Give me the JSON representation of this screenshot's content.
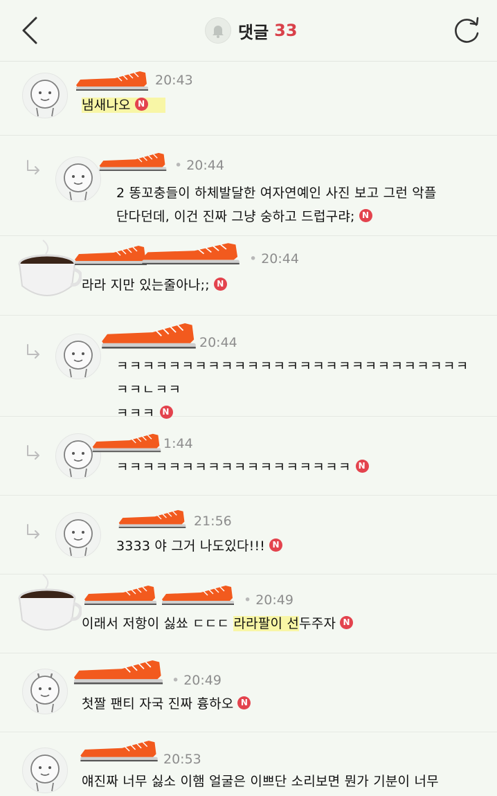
{
  "header": {
    "title": "댓글",
    "count": "33",
    "accent_color": "#d9414a",
    "back_icon": "chevron-left-icon",
    "refresh_icon": "refresh-icon",
    "bell_icon": "bell-icon"
  },
  "badge": "N",
  "comments": [
    {
      "time": "20:43",
      "text_a": "냄새나오",
      "text_b": "",
      "text_c": ""
    },
    {
      "time": "20:44",
      "text_a": "2 똥꼬충들이 하체발달한 여자연예인 사진 보고 그런 악플\n단다던데, 이건 진짜 그냥 숭하고 드럽구랴;",
      "text_b": "",
      "text_c": ""
    },
    {
      "time": "20:44",
      "text_a": "라라 지만 있는줄아나;;",
      "text_b": "",
      "text_c": ""
    },
    {
      "time": "20:44",
      "text_a": "ㅋㅋㅋㅋㅋㅋㅋㅋㅋㅋㅋㅋㅋㅋㅋㅋㅋㅋㅋㅋㅋㅋㅋㅋㅋㅋㅋㅋㅋㄴㅋㅋ\nㅋㅋㅋ",
      "text_b": "",
      "text_c": ""
    },
    {
      "time": "1:44",
      "text_a": "ㅋㅋㅋㅋㅋㅋㅋㅋㅋㅋㅋㅋㅋㅋㅋㅋㅋㅋ",
      "text_b": "",
      "text_c": ""
    },
    {
      "time": "21:56",
      "text_a": "3333 야 그거 나도있다!!!",
      "text_b": "",
      "text_c": ""
    },
    {
      "time": "20:49",
      "text_a": "이래서 저항이 싫쑈 ㄷㄷㄷ ",
      "text_b": "라라팔이 선",
      "text_c": "두주자"
    },
    {
      "time": "20:49",
      "text_a": "첫짤 팬티 자국 진짜 흉하오",
      "text_b": "",
      "text_c": ""
    },
    {
      "time": "20:53",
      "text_a": "얘진짜 너무 싫소 이햄 얼굴은 이쁘단 소리보면 뭔가 기분이 너무",
      "text_b": "",
      "text_c": ""
    }
  ]
}
